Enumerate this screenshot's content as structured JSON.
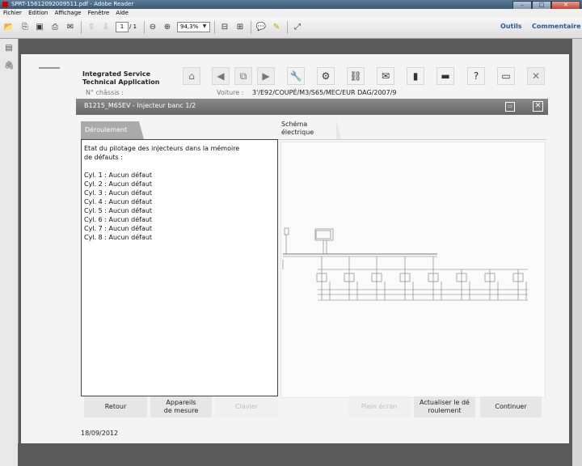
{
  "window": {
    "title": "SPRT-15612092009511.pdf - Adobe Reader",
    "buttons": {
      "minimize": "–",
      "maximize": "□",
      "close": "✕"
    }
  },
  "menu": [
    "Fichier",
    "Edition",
    "Affichage",
    "Fenêtre",
    "Aide"
  ],
  "toolbar": {
    "page_current": "1",
    "page_total": "/ 1",
    "zoom": "94,3%",
    "outils": "Outils",
    "commentaire": "Commentaire"
  },
  "document": {
    "app_title_line1": "Integrated Service",
    "app_title_line2": "Technical Application",
    "chassis_label": "N° châssis :",
    "voiture_label": "Voiture :",
    "voiture_value": "3'/E92/COUPÉ/M3/S65/MEC/EUR DAG/2007/9",
    "panel_title": "B1215_M65EV - Injecteur banc 1/2",
    "tab_deroulement": "Déroulement",
    "tab_schema_line1": "Schéma",
    "tab_schema_line2": "électrique",
    "content_text": "Etat du pilotage des injecteurs dans la mémoire\nde défauts :\n\nCyl. 1 : Aucun défaut\nCyl. 2 : Aucun défaut\nCyl. 3 : Aucun défaut\nCyl. 4 : Aucun défaut\nCyl. 5 : Aucun défaut\nCyl. 6 : Aucun défaut\nCyl. 7 : Aucun défaut\nCyl. 8 : Aucun défaut",
    "buttons": {
      "retour": "Retour",
      "appareils_line1": "Appareils",
      "appareils_line2": "de mesure",
      "clavier": "Clavier",
      "plein_ecran": "Plein écran",
      "actualiser_line1": "Actualiser le dé",
      "actualiser_line2": "roulement",
      "continuer": "Continuer"
    },
    "date": "18/09/2012"
  }
}
